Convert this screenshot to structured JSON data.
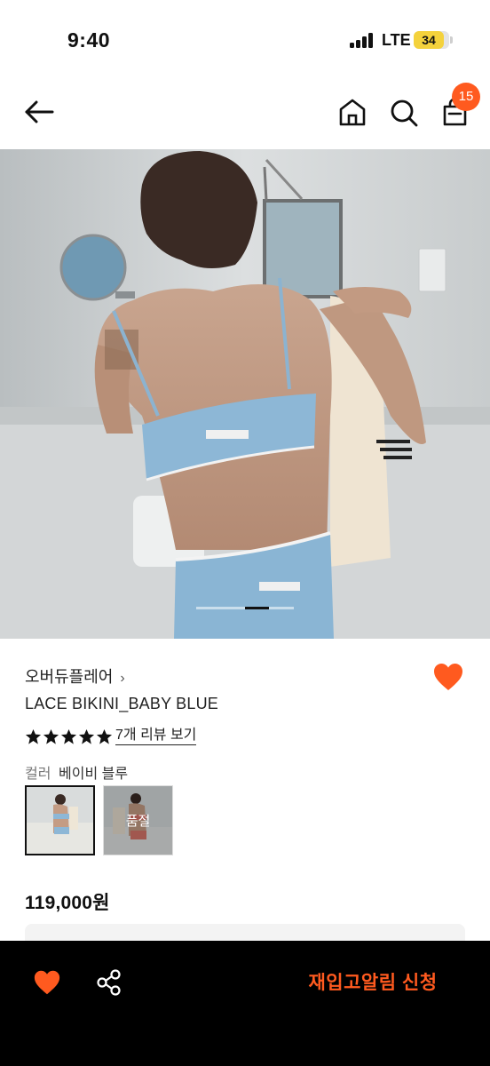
{
  "status_bar": {
    "time": "9:40",
    "network": "LTE",
    "battery": "34"
  },
  "nav": {
    "cart_count": "15"
  },
  "product": {
    "brand": "오버듀플레어",
    "brand_chevron": "›",
    "name": "LACE BIKINI_BABY BLUE",
    "rating_stars": 5,
    "review_link": "7개 리뷰 보기",
    "option_label": "컬러",
    "option_value": "베이비 블루",
    "soldout_label": "품절",
    "price": "119,000원"
  },
  "bottom_bar": {
    "restock_label": "재입고알림 신청"
  },
  "colors": {
    "accent": "#ff5a1f",
    "bottom_bar_bg": "#000000",
    "text": "#222222"
  },
  "icons": [
    "back-arrow-icon",
    "home-icon",
    "search-icon",
    "cart-icon",
    "heart-icon",
    "star-icon",
    "share-icon"
  ]
}
